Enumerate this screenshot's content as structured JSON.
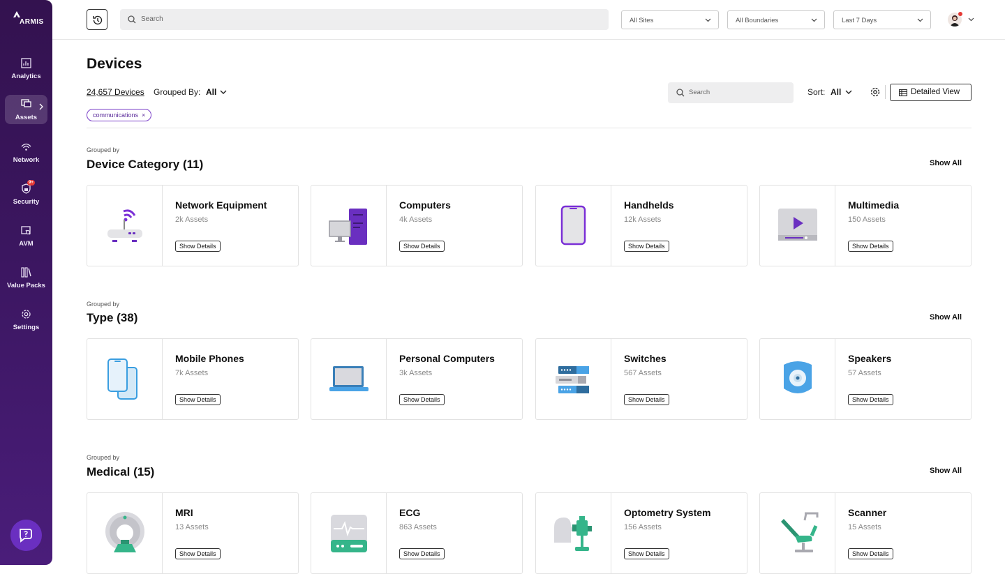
{
  "brand": {
    "name": "ARMIS"
  },
  "sidebar": {
    "items": [
      {
        "label": "Analytics",
        "icon": "chart-icon"
      },
      {
        "label": "Assets",
        "icon": "assets-icon"
      },
      {
        "label": "Network",
        "icon": "network-icon"
      },
      {
        "label": "Security",
        "icon": "security-icon",
        "badge": "9+"
      },
      {
        "label": "AVM",
        "icon": "avm-icon"
      },
      {
        "label": "Value Packs",
        "icon": "value-packs-icon"
      },
      {
        "label": "Settings",
        "icon": "settings-icon"
      }
    ]
  },
  "topbar": {
    "search_placeholder": "Search",
    "filters": [
      "All Sites",
      "All Boundaries",
      "Last 7 Days"
    ]
  },
  "page": {
    "title": "Devices",
    "count": "24,657 Devices",
    "grouped_by_label": "Grouped By:",
    "grouped_by_value": "All",
    "chip": "communications",
    "search_placeholder": "Search",
    "sort_label": "Sort:",
    "sort_value": "All",
    "view_button": "Detailed View"
  },
  "groups": [
    {
      "kicker": "Grouped by",
      "title": "Device Category (11)",
      "show_all": "Show All",
      "cards": [
        {
          "title": "Network Equipment",
          "sub": "2k Assets",
          "button": "Show Details"
        },
        {
          "title": "Computers",
          "sub": "4k Assets",
          "button": "Show Details"
        },
        {
          "title": "Handhelds",
          "sub": "12k Assets",
          "button": "Show Details"
        },
        {
          "title": "Multimedia",
          "sub": "150 Assets",
          "button": "Show Details"
        }
      ]
    },
    {
      "kicker": "Grouped by",
      "title": "Type (38)",
      "show_all": "Show All",
      "cards": [
        {
          "title": "Mobile Phones",
          "sub": "7k Assets",
          "button": "Show Details"
        },
        {
          "title": "Personal Computers",
          "sub": "3k Assets",
          "button": "Show Details"
        },
        {
          "title": "Switches",
          "sub": "567 Assets",
          "button": "Show Details"
        },
        {
          "title": "Speakers",
          "sub": "57 Assets",
          "button": "Show Details"
        }
      ]
    },
    {
      "kicker": "Grouped by",
      "title": "Medical (15)",
      "show_all": "Show All",
      "cards": [
        {
          "title": "MRI",
          "sub": "13 Assets",
          "button": "Show Details"
        },
        {
          "title": "ECG",
          "sub": "863 Assets",
          "button": "Show Details"
        },
        {
          "title": "Optometry System",
          "sub": "156 Assets",
          "button": "Show Details"
        },
        {
          "title": "Scanner",
          "sub": "15 Assets",
          "button": "Show Details"
        }
      ]
    }
  ],
  "colors": {
    "sidebar": "#3b1660",
    "accent": "#6a2fc0",
    "chip_border": "#7a3fc8"
  }
}
